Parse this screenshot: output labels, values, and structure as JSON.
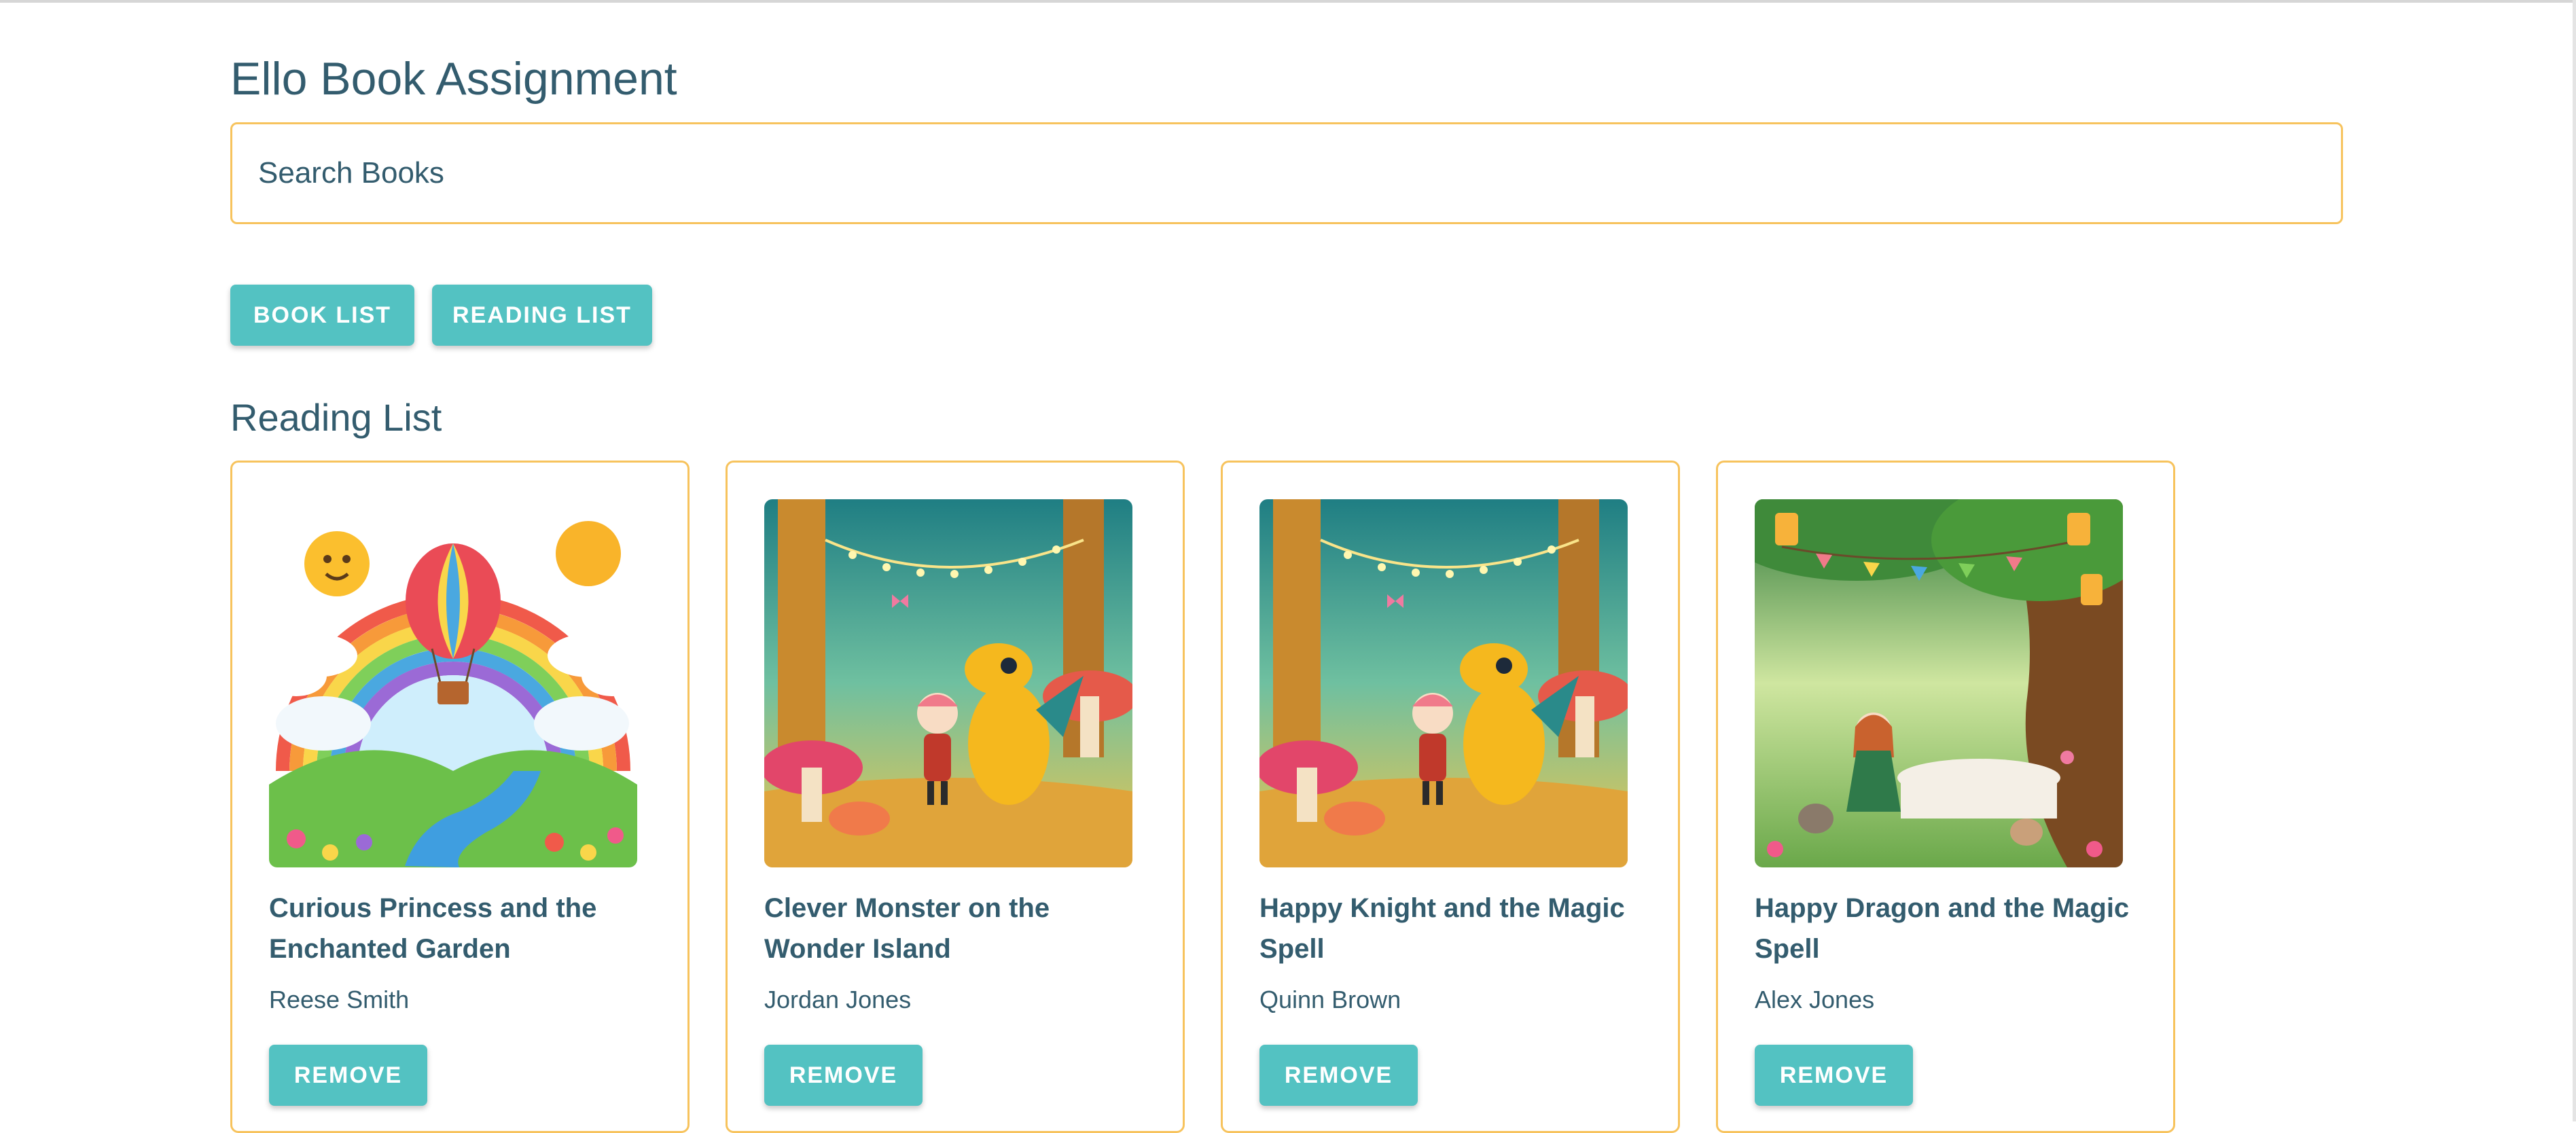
{
  "app": {
    "title": "Ello Book Assignment"
  },
  "search": {
    "placeholder": "Search Books",
    "value": ""
  },
  "nav": {
    "book_list_label": "BOOK LIST",
    "reading_list_label": "READING LIST"
  },
  "reading_list": {
    "heading": "Reading List",
    "books": [
      {
        "title": "Curious Princess and the Enchanted Garden",
        "author": "Reese Smith",
        "remove_label": "REMOVE",
        "image": "rainbow-hot-air-balloon-illustration"
      },
      {
        "title": "Clever Monster on the Wonder Island",
        "author": "Jordan Jones",
        "remove_label": "REMOVE",
        "image": "forest-dragon-and-girl-illustration"
      },
      {
        "title": "Happy Knight and the Magic Spell",
        "author": "Quinn Brown",
        "remove_label": "REMOVE",
        "image": "forest-dragon-and-girl-illustration"
      },
      {
        "title": "Happy Dragon and the Magic Spell",
        "author": "Alex Jones",
        "remove_label": "REMOVE",
        "image": "forest-tea-party-illustration"
      }
    ]
  },
  "colors": {
    "text": "#335c6e",
    "accent_button": "#53c2c2",
    "border_accent": "#f7c35d",
    "background": "#ffffff"
  }
}
